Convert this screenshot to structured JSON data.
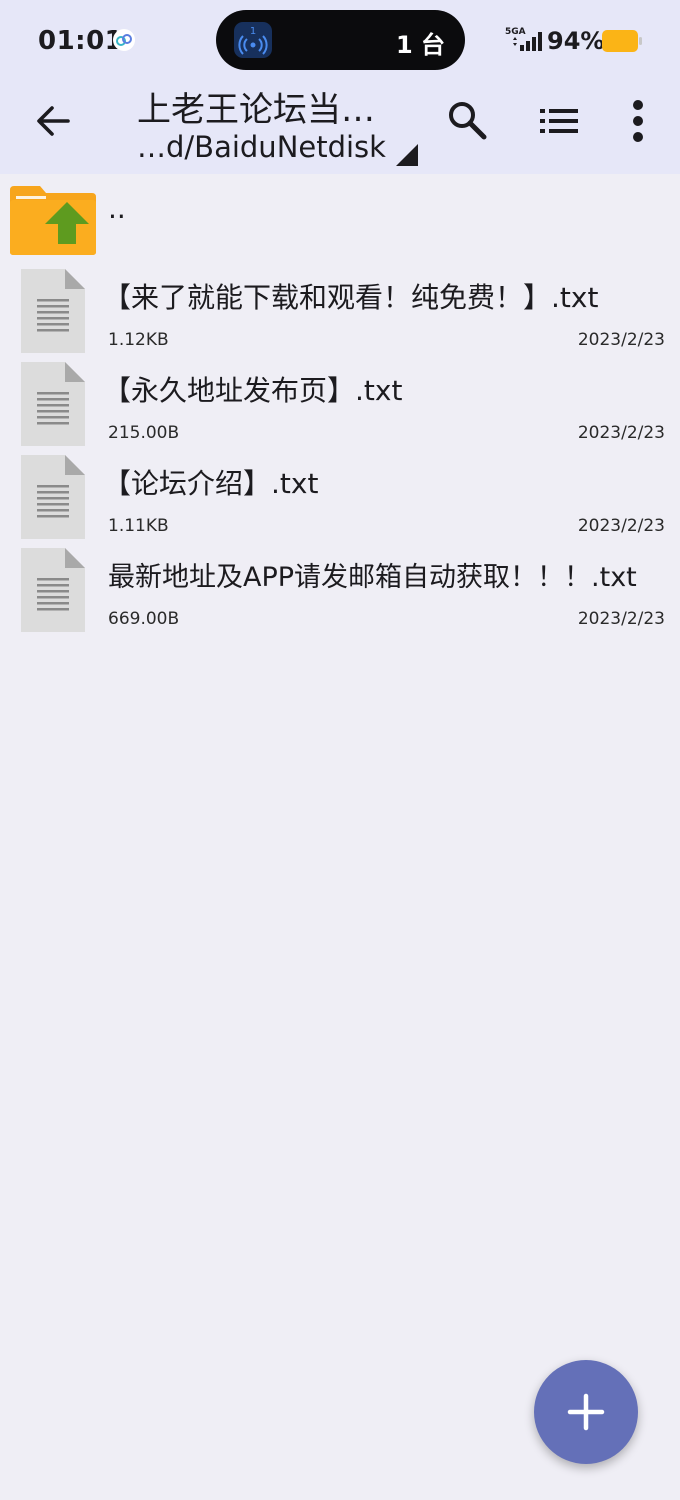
{
  "status_bar": {
    "time": "01:01",
    "island_count": "1 台",
    "network": "5GA",
    "battery": "94%"
  },
  "app_bar": {
    "title": "上老王论坛当…",
    "path": "…d/BaiduNetdisk"
  },
  "parent_entry": {
    "label": ".."
  },
  "files": [
    {
      "name": "【来了就能下载和观看！纯免费！】.txt",
      "size": "1.12KB",
      "date": "2023/2/23"
    },
    {
      "name": "【永久地址发布页】.txt",
      "size": "215.00B",
      "date": "2023/2/23"
    },
    {
      "name": "【论坛介绍】.txt",
      "size": "1.11KB",
      "date": "2023/2/23"
    },
    {
      "name": "最新地址及APP请发邮箱自动获取！！！.txt",
      "size": "669.00B",
      "date": "2023/2/23"
    }
  ],
  "colors": {
    "app_bar_bg": "#e6e7f8",
    "background": "#efeef5",
    "fab": "#6470b8",
    "folder": "#f7a51c",
    "folder_arrow": "#5e9b1f",
    "battery": "#fbb416"
  }
}
